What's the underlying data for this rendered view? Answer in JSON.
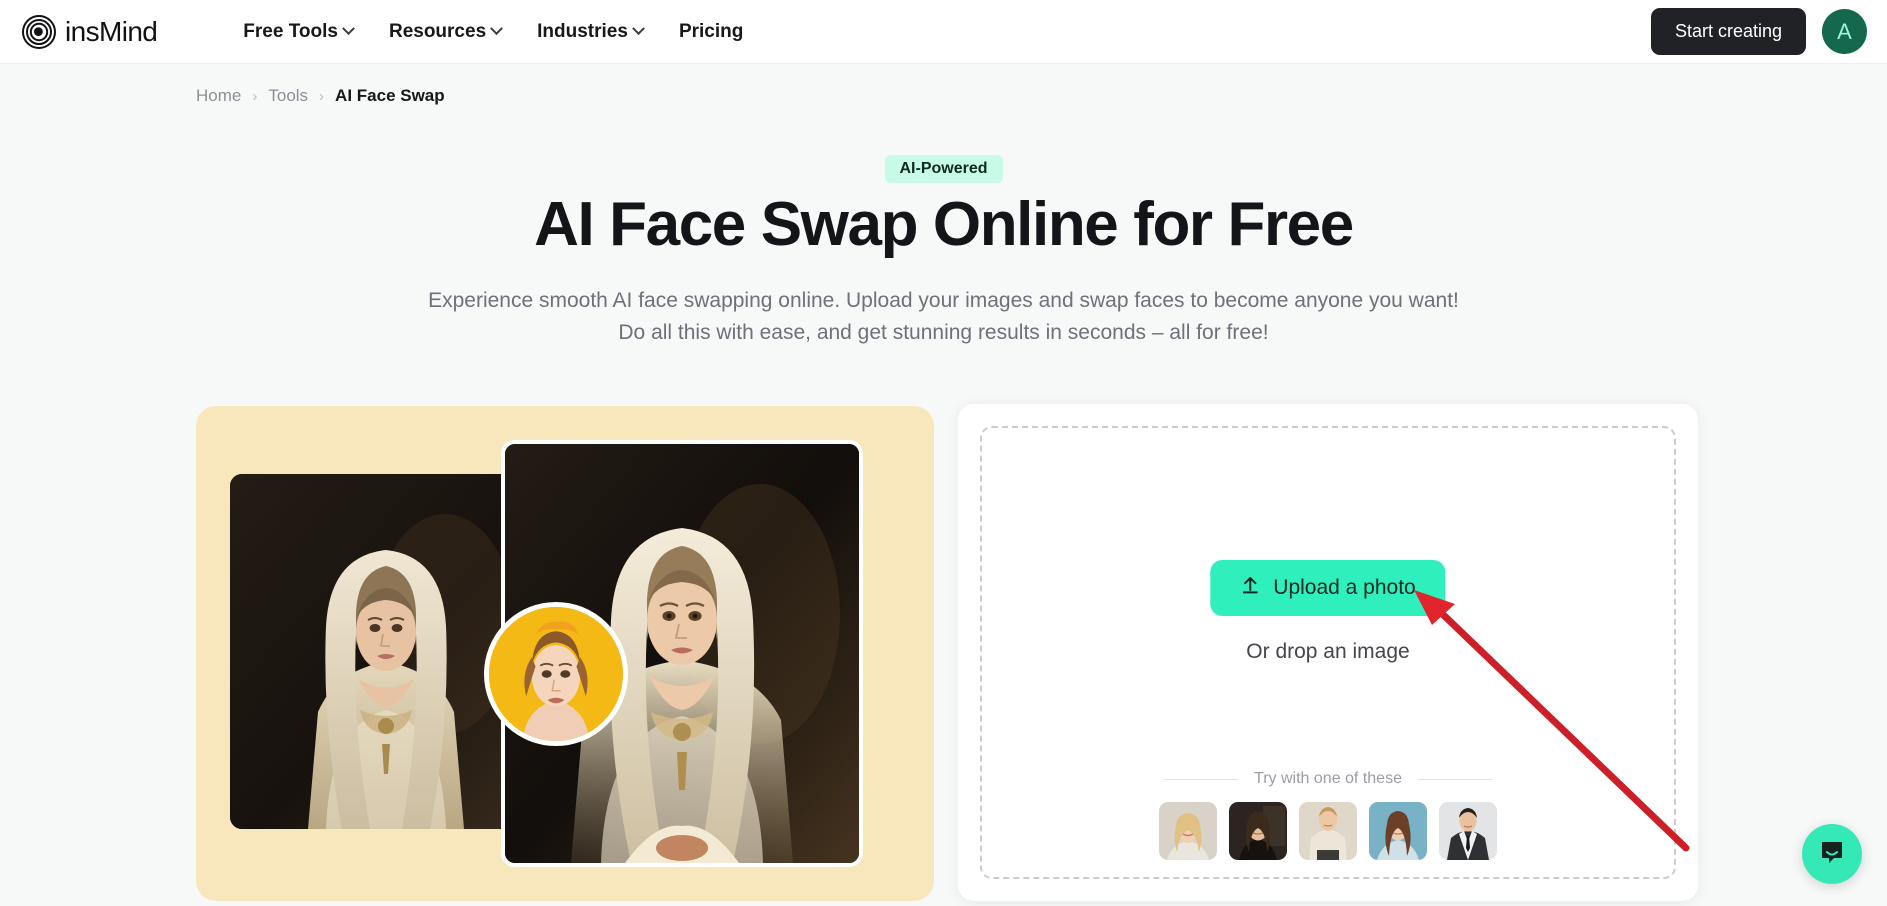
{
  "brand": {
    "name": "insMind",
    "logo_icon": "concentric-circles-logo"
  },
  "header": {
    "nav": [
      {
        "label": "Free Tools",
        "has_dropdown": true
      },
      {
        "label": "Resources",
        "has_dropdown": true
      },
      {
        "label": "Industries",
        "has_dropdown": true
      },
      {
        "label": "Pricing",
        "has_dropdown": false
      }
    ],
    "cta_label": "Start creating",
    "avatar_initial": "A"
  },
  "breadcrumb": {
    "items": [
      "Home",
      "Tools",
      "AI Face Swap"
    ],
    "separator": "›"
  },
  "hero": {
    "badge": "AI-Powered",
    "title": "AI Face Swap Online for Free",
    "subtitle_line1": "Experience smooth AI face swapping online. Upload your images and swap faces to become anyone you want!",
    "subtitle_line2": "Do all this with ease, and get stunning results in seconds – all for free!"
  },
  "demo": {
    "before_alt": "before-portrait",
    "after_alt": "after-portrait",
    "face_source_alt": "source-face-thumbnail",
    "arrow_icon": "arrow-right-icon",
    "card_bg": "#f8e7bd",
    "arrow_color": "#2fe0b0",
    "face_bubble_bg": "#f5b916"
  },
  "upload": {
    "button_label": "Upload a photo",
    "upload_icon": "upload-arrow-icon",
    "drop_hint": "Or drop an image",
    "try_label": "Try with one of these",
    "samples": [
      {
        "name": "sample-blonde-woman",
        "bg": "#d8d2c9"
      },
      {
        "name": "sample-dark-portrait",
        "bg": "#2c2420"
      },
      {
        "name": "sample-man-hoodie",
        "bg": "#dfd7c9"
      },
      {
        "name": "sample-woman-blue-bg",
        "bg": "#79b2c7"
      },
      {
        "name": "sample-man-suit",
        "bg": "#e3e4e6"
      }
    ],
    "accent_color": "#2ff0bd"
  },
  "annotation": {
    "arrow_color": "#cc1f28",
    "target": "upload-a-photo-button"
  },
  "chat": {
    "icon": "chat-bubble-icon",
    "bg_color": "#35e9b6"
  }
}
